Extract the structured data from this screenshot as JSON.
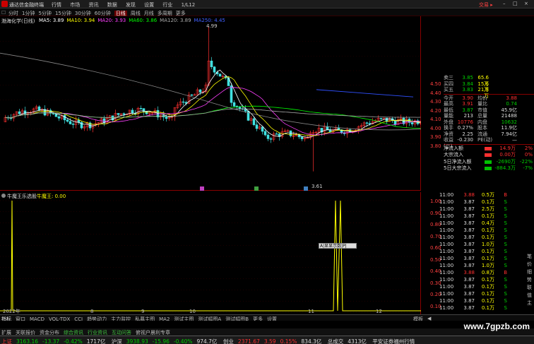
{
  "window": {
    "title": "通达信金融终端",
    "menu": [
      "行情",
      "市场",
      "资讯",
      "数据",
      "发现",
      "设置",
      "行业",
      "1/L12"
    ],
    "trade_label": "交易 ▸",
    "controls": [
      "–",
      "□",
      "×"
    ]
  },
  "period_tabs": [
    "分时",
    "1分钟",
    "5分钟",
    "15分钟",
    "30分钟",
    "60分钟",
    "日线",
    "周线",
    "月线",
    "多周期",
    "更多"
  ],
  "active_period": "日线",
  "main_chart": {
    "stock_title": "渤海化学(日线)",
    "ma_legend": [
      {
        "label": "MA5: 3.89",
        "color": "#ffffff"
      },
      {
        "label": "MA10: 3.94",
        "color": "#ffff00"
      },
      {
        "label": "MA20: 3.93",
        "color": "#ff40ff"
      },
      {
        "label": "MA60: 3.86",
        "color": "#00ff00"
      },
      {
        "label": "MA120: 3.89",
        "color": "#aaaaaa"
      },
      {
        "label": "MA250: 4.45",
        "color": "#4060ff"
      }
    ],
    "high_label": "4.99",
    "low_label": "3.61",
    "price_axis": [
      "4.50",
      "4.40",
      "4.30",
      "4.20",
      "4.10",
      "4.00",
      "3.90",
      "3.80"
    ]
  },
  "chart_data": {
    "type": "candlestick",
    "note_values": "visible price extremes",
    "max_high": 4.99,
    "min_low": 3.61,
    "y_axis_ticks": [
      4.5,
      4.4,
      4.3,
      4.2,
      4.1,
      4.0,
      3.9,
      3.8
    ],
    "indicator": {
      "name": "牛魔王",
      "value": 0.0,
      "y_axis_ticks": [
        1.0,
        0.9,
        0.8,
        0.7,
        0.6,
        0.5,
        0.4,
        0.3,
        0.2,
        0.1,
        0.0
      ]
    }
  },
  "indicator_chart": {
    "title": "牛魔王乐选股",
    "series_label": "牛魔王: 0.00",
    "axis": [
      "1.00",
      "0.90",
      "0.80",
      "0.70",
      "0.60",
      "0.50",
      "0.40",
      "0.30",
      "0.20",
      "0.10",
      "0.00"
    ],
    "x_labels": [
      "2022年",
      "8",
      "9",
      "10",
      "11",
      "12"
    ],
    "tooltip": "A|显显示数|P|"
  },
  "quote": {
    "ask": [
      {
        "label": "卖三",
        "price": "3.85",
        "vol": "65.6万"
      },
      {
        "label": "买四",
        "price": "3.84",
        "vol": "15.6万"
      },
      {
        "label": "买五",
        "price": "3.83",
        "vol": "21.8万"
      }
    ],
    "stats": [
      {
        "l1": "今开",
        "v1": "3.90",
        "l2": "均价",
        "v2": "3.88"
      },
      {
        "l1": "最高",
        "v1": "3.91",
        "l2": "量比",
        "v2": "0.74"
      },
      {
        "l1": "最低",
        "v1": "3.87",
        "l2": "市值",
        "v2": "45.9亿"
      },
      {
        "l1": "量能",
        "v1": "213",
        "l2": "总量",
        "v2": "21488"
      },
      {
        "l1": "外盘",
        "v1": "10776",
        "l2": "内盘",
        "v2": "10632"
      },
      {
        "l1": "换手",
        "v1": "0.27%",
        "l2": "股本",
        "v2": "11.9亿"
      },
      {
        "l1": "净资",
        "v1": "2.25",
        "l2": "流通",
        "v2": "7.94亿"
      },
      {
        "l1": "收益(三)",
        "v1": "-0.230",
        "l2": "PE(动)",
        "v2": "—"
      }
    ],
    "flows": [
      {
        "label": "净流入额",
        "value": "14.9万",
        "pct": "2%"
      },
      {
        "label": "大宗流入",
        "value": "0.00万",
        "pct": "0%"
      },
      {
        "label": "5日净流入额",
        "value": "-2690万",
        "pct": "-22%"
      },
      {
        "label": "5日大宗流入",
        "value": "-884.3万",
        "pct": "-7%"
      }
    ],
    "right_axis": [
      "4.50",
      "4.40",
      "4.30",
      "4.20",
      "4.10",
      "4.00",
      "3.90",
      "3.80"
    ]
  },
  "ticks": [
    {
      "time": "11:00",
      "price": "3.88",
      "vol": "0.5万",
      "side": "B"
    },
    {
      "time": "11:00",
      "price": "3.87",
      "vol": "0.1万",
      "side": "S"
    },
    {
      "time": "11:00",
      "price": "3.87",
      "vol": "2.5万",
      "side": "S"
    },
    {
      "time": "11:00",
      "price": "3.87",
      "vol": "0.1万",
      "side": "S"
    },
    {
      "time": "11:00",
      "price": "3.87",
      "vol": "0.4万",
      "side": "S"
    },
    {
      "time": "11:00",
      "price": "3.87",
      "vol": "0.1万",
      "side": "S"
    },
    {
      "time": "11:00",
      "price": "3.87",
      "vol": "0.1万",
      "side": "S"
    },
    {
      "time": "11:00",
      "price": "3.87",
      "vol": "1.0万",
      "side": "S"
    },
    {
      "time": "11:00",
      "price": "3.87",
      "vol": "0.1万",
      "side": "S"
    },
    {
      "time": "11:00",
      "price": "3.87",
      "vol": "0.1万",
      "side": "S"
    },
    {
      "time": "11:00",
      "price": "3.87",
      "vol": "1.0万",
      "side": "S"
    },
    {
      "time": "11:00",
      "price": "3.88",
      "vol": "0.8万",
      "side": "B"
    },
    {
      "time": "11:00",
      "price": "3.87",
      "vol": "0.1万",
      "side": "S"
    },
    {
      "time": "11:00",
      "price": "3.87",
      "vol": "0.1万",
      "side": "S"
    },
    {
      "time": "11:00",
      "price": "3.87",
      "vol": "0.1万",
      "side": "S"
    },
    {
      "time": "11:00",
      "price": "3.87",
      "vol": "0.1万",
      "side": "S"
    },
    {
      "time": "11:00",
      "price": "3.87",
      "vol": "0.1万",
      "side": "S"
    }
  ],
  "tick_footer": [
    "笔",
    "价",
    "细",
    "势",
    "联",
    "值",
    "主"
  ],
  "bottom_tabs": [
    "指标",
    "窗口",
    "MACD",
    "VOL-TDX",
    "CCI",
    "趋势动力",
    "主力监控",
    "私募主图",
    "MA2",
    "测试主图",
    "测试幅图A",
    "测试幅图B",
    "更多",
    "设置"
  ],
  "sub_tabs": [
    "扩展",
    "关联报价",
    "资金分布",
    "综合资讯",
    "行业资讯",
    "互动问答",
    "俯视户晨利专章"
  ],
  "right_tabs": [
    "模板",
    "◀"
  ],
  "status": {
    "sh_label": "上证",
    "sh_value": "3163.16",
    "sh_change": "-13.37",
    "sh_pct": "-0.42%",
    "sh_amount": "1717亿",
    "hs_label": "沪深",
    "hs_value": "3938.93",
    "hs_change": "-15.96",
    "hs_pct": "-0.40%",
    "hs_amount": "974.7亿",
    "cy_label": "创业",
    "cy_value": "2371.67",
    "cy_change": "3.59",
    "cy_pct": "0.15%",
    "cy_amount": "834.3亿",
    "total_label": "总成交",
    "total_value": "4313亿",
    "info": "平安证券福州行情"
  },
  "watermark": "www.7gpzb.com"
}
